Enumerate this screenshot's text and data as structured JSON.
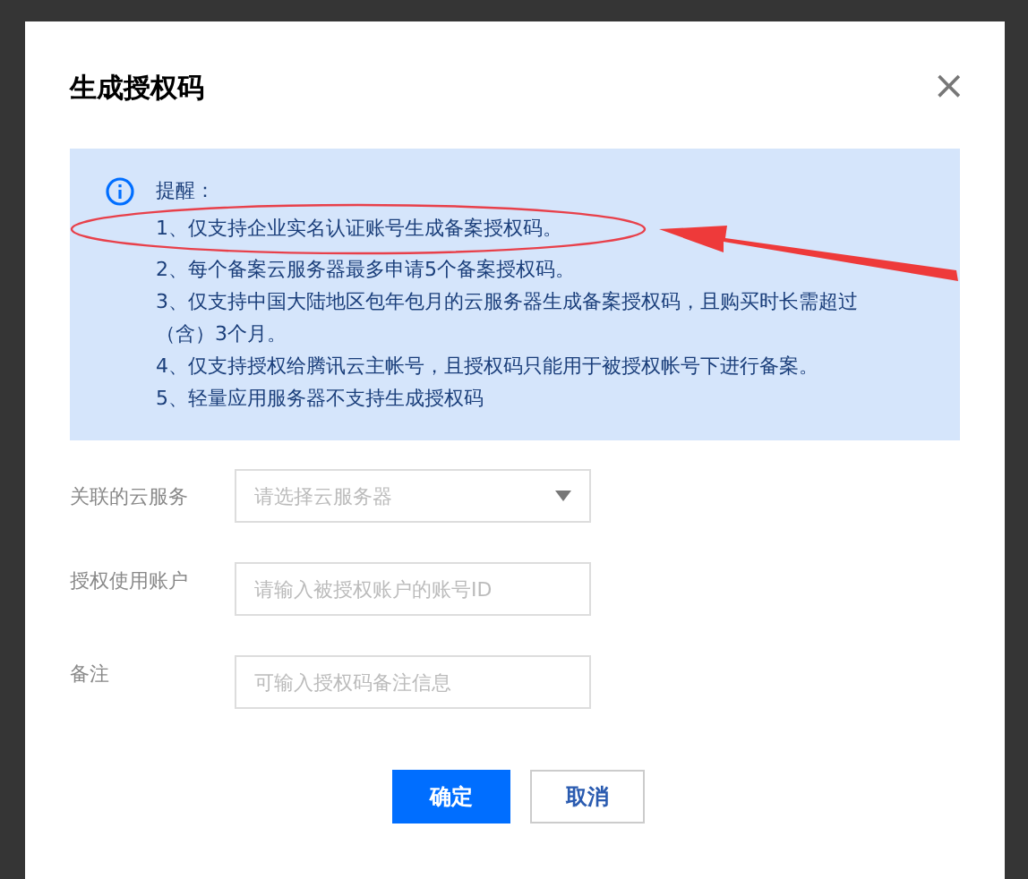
{
  "dialog": {
    "title": "生成授权码",
    "close": "×"
  },
  "notice": {
    "heading": "提醒：",
    "items": [
      "1、仅支持企业实名认证账号生成备案授权码。",
      "2、每个备案云服务器最多申请5个备案授权码。",
      "3、仅支持中国大陆地区包年包月的云服务器生成备案授权码，且购买时长需超过（含）3个月。",
      "4、仅支持授权给腾讯云主帐号，且授权码只能用于被授权帐号下进行备案。",
      "5、轻量应用服务器不支持生成授权码"
    ]
  },
  "form": [
    {
      "label": "关联的云服务",
      "kind": "select",
      "placeholder": "请选择云服务器"
    },
    {
      "label": "授权使用账户",
      "kind": "input",
      "placeholder": "请输入被授权账户的账号ID"
    },
    {
      "label": "备注",
      "kind": "input",
      "placeholder": "可输入授权码备注信息"
    }
  ],
  "buttons": [
    {
      "label": "确定",
      "kind": "primary"
    },
    {
      "label": "取消",
      "kind": "secondary"
    }
  ]
}
